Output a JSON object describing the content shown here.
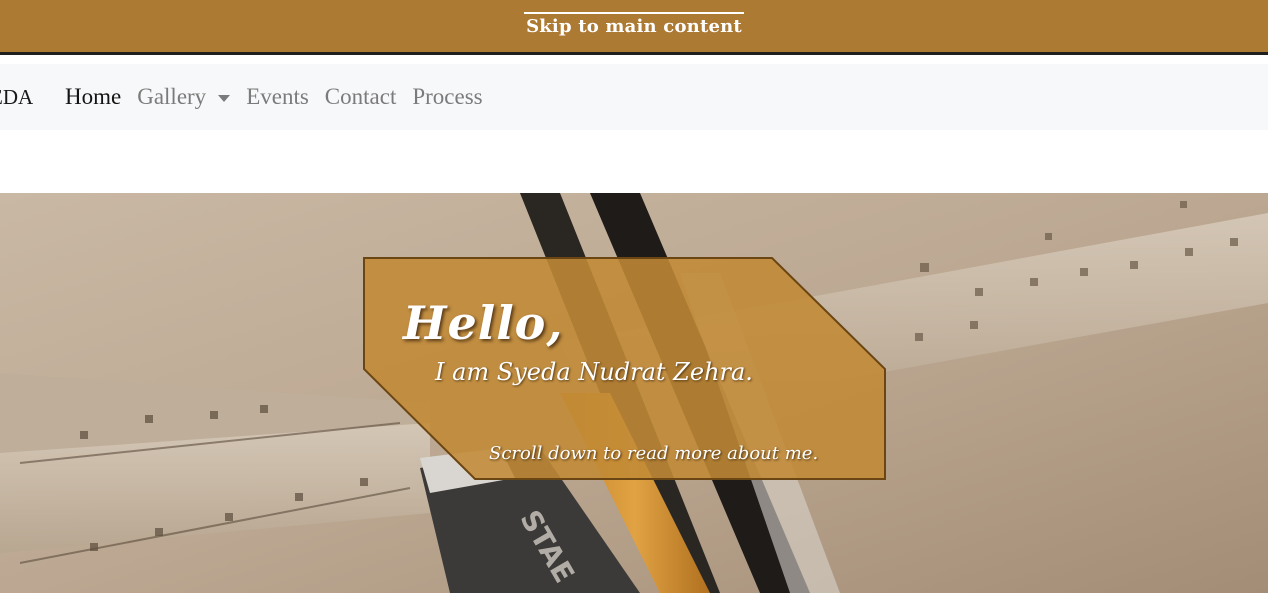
{
  "skip_link": {
    "label": "Skip to main content"
  },
  "navbar": {
    "brand": "EDA",
    "items": [
      {
        "label": "Home",
        "active": true
      },
      {
        "label": "Gallery",
        "dropdown": true
      },
      {
        "label": "Events"
      },
      {
        "label": "Contact"
      },
      {
        "label": "Process"
      }
    ]
  },
  "hero": {
    "greeting": "Hello,",
    "intro": "I am Syeda Nudrat Zehra.",
    "scroll_hint": "Scroll down to read more about me."
  },
  "colors": {
    "accent": "#ad7a34",
    "card_fill": "#c28a36",
    "card_border": "#6b4512",
    "nav_bg": "#f7f8fa",
    "nav_text": "#7b7b7b",
    "nav_active": "#141414"
  }
}
